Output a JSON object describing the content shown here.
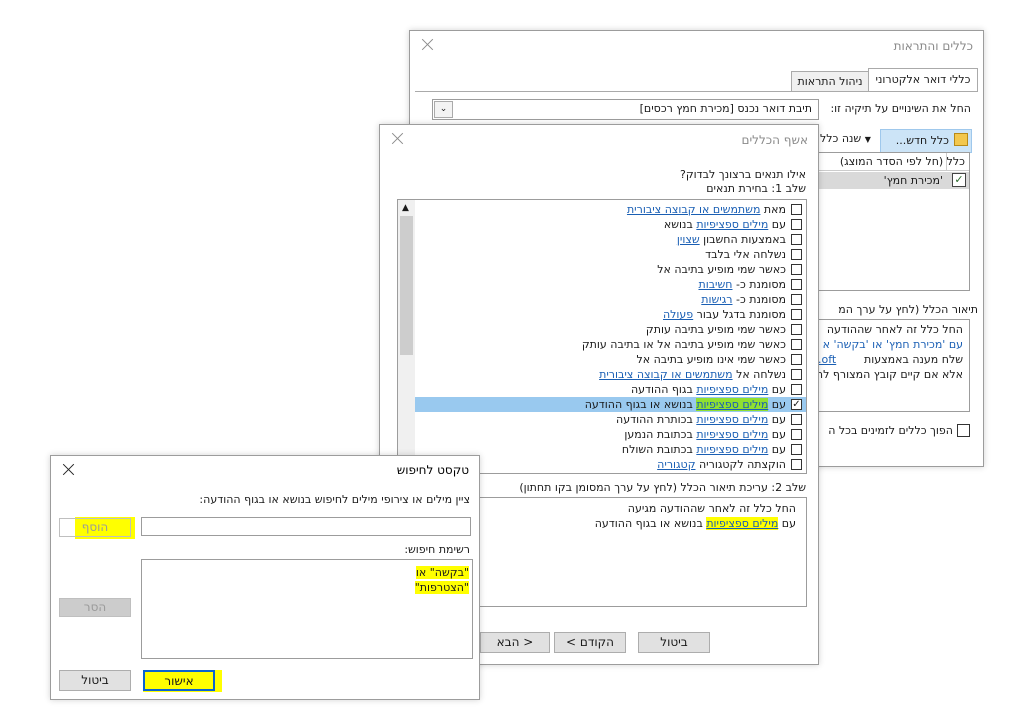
{
  "rules_dialog": {
    "title": "כללים והתראות",
    "tabs": [
      "כללי דואר אלקטרוני",
      "ניהול התראות"
    ],
    "apply_label": "החל את השינויים על תיקיה זו:",
    "folder_value": "תיבת דואר נכנס [מכירת חמץ רכסים]",
    "toolbar_new_rule": "כלל חדש...",
    "toolbar_change_rule": "שנה כלל",
    "rules_header": "כלל (חל לפי הסדר המוצג)",
    "rule_item": "'מכירת חמץ'",
    "desc_label": "תיאור הכלל (לחץ על ערך המ",
    "desc_lines": [
      "החל כלל זה לאחר שההודעה",
      "עם 'מכירת חמץ' או 'בקשה' א",
      "שלח מענה באמצעות",
      "אלא אם קיים קובץ המצורף לה"
    ],
    "desc_link": ".oft",
    "desc_link2": "...mc",
    "bottom_checkbox": "הפוך כללים לזמינים בכל ה"
  },
  "wizard": {
    "title": "אשף הכללים",
    "question": "אילו תנאים ברצונך לבדוק?",
    "step1": "שלב 1: בחירת תנאים",
    "conditions": [
      {
        "pre": "מאת ",
        "link": "משתמשים או קבוצה ציבורית",
        "post": "",
        "checked": false
      },
      {
        "pre": "עם ",
        "link": "מילים ספציפיות",
        "post": " בנושא",
        "checked": false
      },
      {
        "pre": "באמצעות החשבון ",
        "link": "שצוין",
        "post": "",
        "checked": false
      },
      {
        "pre": "נשלחה אלי בלבד",
        "link": "",
        "post": "",
        "checked": false
      },
      {
        "pre": "כאשר שמי מופיע בתיבה אל",
        "link": "",
        "post": "",
        "checked": false
      },
      {
        "pre": "מסומנת כ- ",
        "link": "חשיבות",
        "post": "",
        "checked": false
      },
      {
        "pre": "מסומנת כ- ",
        "link": "רגישות",
        "post": "",
        "checked": false
      },
      {
        "pre": "מסומנת בדגל עבור ",
        "link": "פעולה",
        "post": "",
        "checked": false
      },
      {
        "pre": "כאשר שמי מופיע בתיבה עותק",
        "link": "",
        "post": "",
        "checked": false
      },
      {
        "pre": "כאשר שמי מופיע בתיבה אל או בתיבה עותק",
        "link": "",
        "post": "",
        "checked": false
      },
      {
        "pre": "כאשר שמי אינו מופיע בתיבה אל",
        "link": "",
        "post": "",
        "checked": false
      },
      {
        "pre": "נשלחה אל ",
        "link": "משתמשים או קבוצה ציבורית",
        "post": "",
        "checked": false
      },
      {
        "pre": "עם ",
        "link": "מילים ספציפיות",
        "post": " בגוף ההודעה",
        "checked": false
      },
      {
        "pre": "עם ",
        "link": "מילים ספציפיות",
        "post": " בנושא או בגוף ההודעה",
        "checked": true
      },
      {
        "pre": "עם ",
        "link": "מילים ספציפיות",
        "post": " בכותרת ההודעה",
        "checked": false
      },
      {
        "pre": "עם ",
        "link": "מילים ספציפיות",
        "post": " בכתובת הנמען",
        "checked": false
      },
      {
        "pre": "עם ",
        "link": "מילים ספציפיות",
        "post": " בכתובת השולח",
        "checked": false
      },
      {
        "pre": "הוקצתה לקטגוריה ",
        "link": "קטגוריה",
        "post": "",
        "checked": false
      }
    ],
    "step2": "שלב 2: עריכת תיאור הכלל (לחץ על ערך המסומן בקו תחתון)",
    "step2_line1": "החל כלל זה לאחר שההודעה מגיעה",
    "step2_line2_pre": "עם ",
    "step2_line2_link": "מילים ספציפיות",
    "step2_line2_post": " בנושא או בגוף ההודעה",
    "btn_cancel": "ביטול",
    "btn_back": "< הקודם",
    "btn_next": "הבא >"
  },
  "search_dialog": {
    "title": "טקסט לחיפוש",
    "instruction": "ציין מילים או צירופי מילים לחיפוש בנושא או בגוף ההודעה:",
    "input_value": "",
    "add_button": "הוסף",
    "list_label": "רשימת חיפוש:",
    "list_items": [
      "\"בקשה\" או",
      "\"הצטרפות\""
    ],
    "remove_button": "הסר",
    "ok_button": "אישור",
    "cancel_button": "ביטול"
  },
  "colors": {
    "highlight": "#ffff00",
    "selection": "#99c9ef",
    "link": "#1a5fb4"
  }
}
